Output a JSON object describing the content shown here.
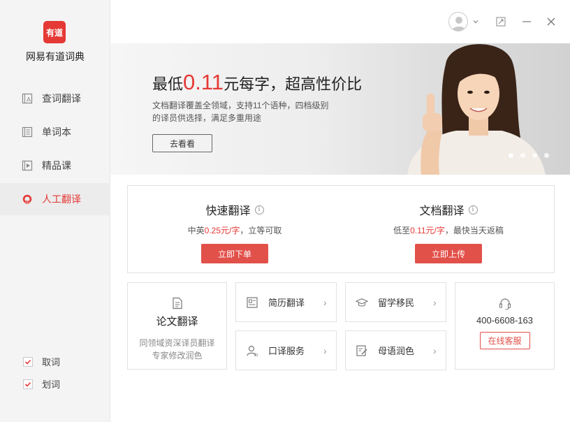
{
  "sidebar": {
    "logo_text": "有道",
    "app_name": "网易有道词典",
    "items": [
      {
        "label": "查词翻译",
        "icon": "dictionary-icon"
      },
      {
        "label": "单词本",
        "icon": "wordbook-icon"
      },
      {
        "label": "精品课",
        "icon": "course-icon"
      },
      {
        "label": "人工翻译",
        "icon": "human-translate-icon",
        "active": true
      }
    ],
    "checks": [
      {
        "label": "取词",
        "checked": true
      },
      {
        "label": "划词",
        "checked": true
      }
    ]
  },
  "titlebar": {
    "avatar": "user-avatar",
    "buttons": [
      "expand-icon",
      "minimize-icon",
      "close-icon"
    ]
  },
  "banner": {
    "title_prefix": "最低",
    "title_price": "0.11",
    "title_suffix": "元每字，超高性价比",
    "subtitle_line1": "文档翻译覆盖全领域，支持11个语种，四档级别",
    "subtitle_line2": "的译员供选择，满足多重用途",
    "button": "去看看",
    "dots_count": 4,
    "active_dot": 0
  },
  "services": {
    "fast": {
      "title": "快速翻译",
      "desc_prefix": "中英",
      "desc_price": "0.25元/字",
      "desc_suffix": "，立等可取",
      "button": "立即下单"
    },
    "doc": {
      "title": "文档翻译",
      "desc_prefix": "低至",
      "desc_price": "0.11元/字",
      "desc_suffix": "，最快当天返稿",
      "button": "立即上传"
    }
  },
  "thesis": {
    "title": "论文翻译",
    "desc_line1": "同领域资深译员翻译",
    "desc_line2": "专家修改润色"
  },
  "mini_services": [
    {
      "label": "简历翻译",
      "icon": "resume-icon"
    },
    {
      "label": "留学移民",
      "icon": "graduation-cap-icon"
    },
    {
      "label": "口译服务",
      "icon": "interpreter-icon"
    },
    {
      "label": "母语润色",
      "icon": "polish-edit-icon"
    }
  ],
  "contact": {
    "phone": "400-6608-163",
    "button": "在线客服"
  },
  "colors": {
    "accent": "#e53935",
    "button_red": "#e2504a"
  }
}
